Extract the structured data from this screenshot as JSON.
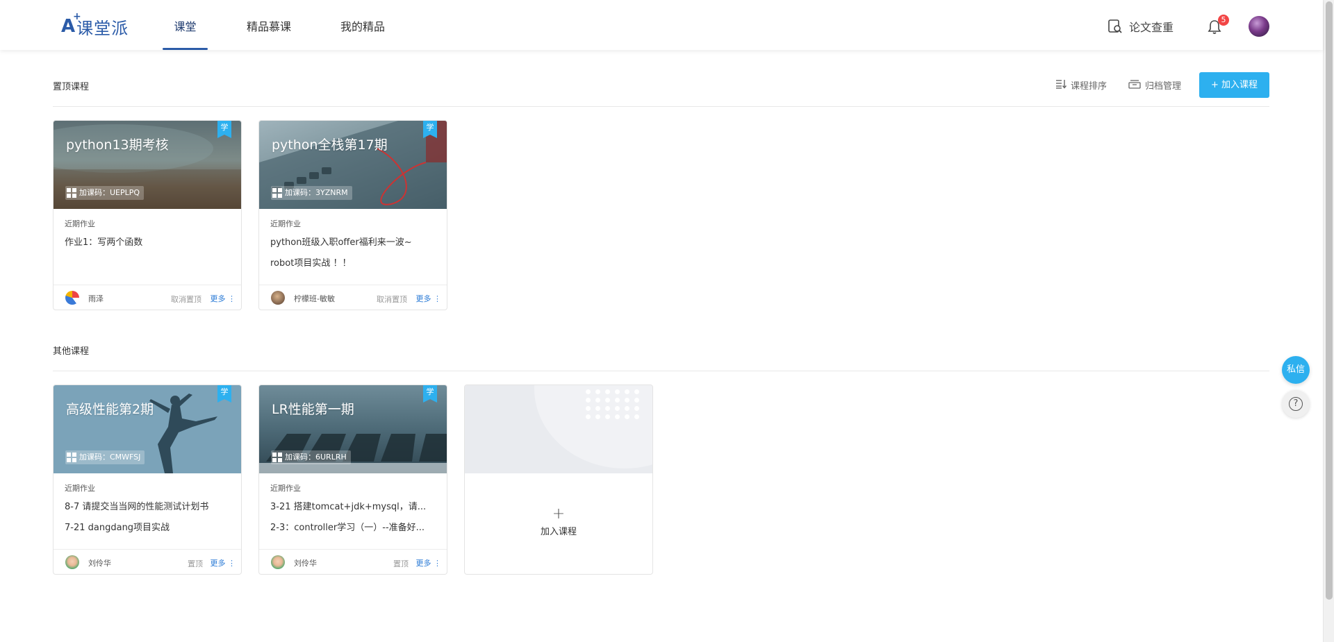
{
  "brand": {
    "logo_mark": "A",
    "logo_text": "课堂派"
  },
  "nav": {
    "tabs": [
      {
        "label": "课堂",
        "active": true
      },
      {
        "label": "精品慕课",
        "active": false
      },
      {
        "label": "我的精品",
        "active": false
      }
    ],
    "plagiarism_check": "论文查重",
    "notification_count": "5"
  },
  "pinned": {
    "title": "置顶课程",
    "sort_label": "课程排序",
    "archive_label": "归档管理",
    "add_label": "+ 加入课程",
    "courses": [
      {
        "title": "python13期考核",
        "ribbon": "学",
        "code": "加课码：UEPLPQ",
        "homework_label": "近期作业",
        "homework": [
          "作业1：写两个函数"
        ],
        "teacher": "雨泽",
        "pin_action": "取消置顶",
        "more": "更多"
      },
      {
        "title": "python全栈第17期",
        "ribbon": "学",
        "code": "加课码：3YZNRM",
        "homework_label": "近期作业",
        "homework": [
          "python班级入职offer福利来一波~",
          "robot项目实战 ！！"
        ],
        "teacher": "柠檬班-敏敏",
        "pin_action": "取消置顶",
        "more": "更多"
      }
    ]
  },
  "others": {
    "title": "其他课程",
    "courses": [
      {
        "title": "高级性能第2期",
        "ribbon": "学",
        "code": "加课码：CMWFSJ",
        "homework_label": "近期作业",
        "homework": [
          "8-7 请提交当当网的性能测试计划书",
          "7-21 dangdang项目实战"
        ],
        "teacher": "刘伶华",
        "pin_action": "置顶",
        "more": "更多"
      },
      {
        "title": "LR性能第一期",
        "ribbon": "学",
        "code": "加课码：6URLRH",
        "homework_label": "近期作业",
        "homework": [
          "3-21 搭建tomcat+jdk+mysql，请...",
          "2-3：controller学习（一）--准备好..."
        ],
        "teacher": "刘伶华",
        "pin_action": "置顶",
        "more": "更多"
      }
    ],
    "add_card": {
      "plus": "+",
      "label": "加入课程"
    }
  },
  "floating": {
    "message": "私信",
    "help": "?"
  },
  "colors": {
    "accent": "#2db0ef",
    "brand": "#2b5ba8",
    "link": "#2b7bd6"
  }
}
